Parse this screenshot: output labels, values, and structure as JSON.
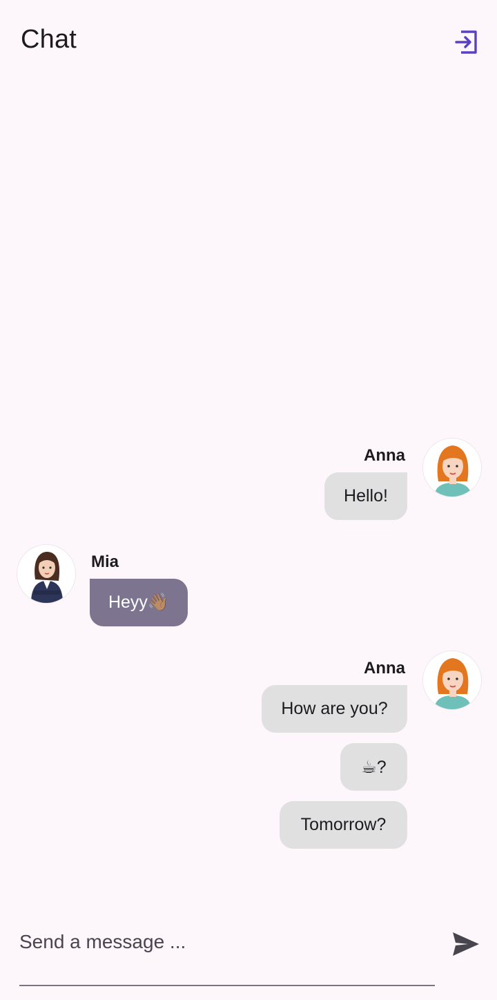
{
  "header": {
    "title": "Chat",
    "logout_icon": "logout-icon",
    "accent_color": "#5b3fc4"
  },
  "messages": [
    {
      "sender": "Anna",
      "side": "right",
      "texts": [
        "Hello!"
      ]
    },
    {
      "sender": "Mia",
      "side": "left",
      "texts": [
        "Heyy👋🏽"
      ]
    },
    {
      "sender": "Anna",
      "side": "right",
      "texts": [
        "How are you?",
        "☕?",
        "Tomorrow?"
      ]
    }
  ],
  "composer": {
    "placeholder": "Send a message ...",
    "send_icon": "send-icon"
  },
  "colors": {
    "background": "#fdf7fb",
    "my_bubble": "#e0e0e0",
    "their_bubble": "#7d7590"
  }
}
